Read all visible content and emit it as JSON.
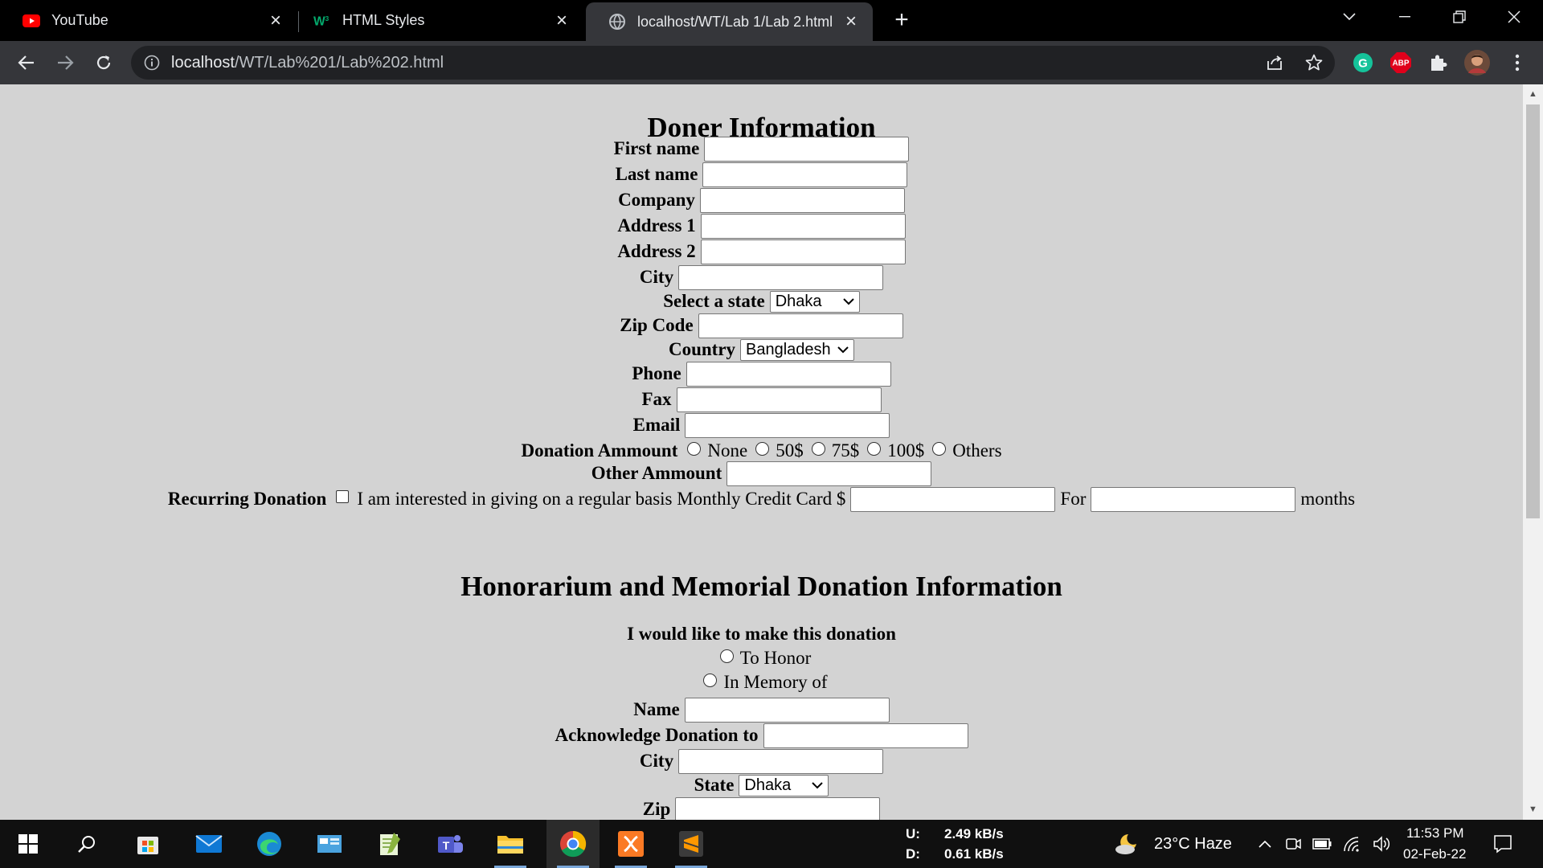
{
  "browser": {
    "tabs": [
      {
        "title": "YouTube",
        "active": false
      },
      {
        "title": "HTML Styles",
        "active": false
      },
      {
        "title": "localhost/WT/Lab 1/Lab 2.html",
        "active": true
      }
    ],
    "url_host": "localhost",
    "url_path": "/WT/Lab%201/Lab%202.html",
    "extension_abp_label": "ABP"
  },
  "page": {
    "donor_heading": "Doner Information",
    "fields": {
      "first_name": "First name",
      "last_name": "Last name",
      "company": "Company",
      "address1": "Address 1",
      "address2": "Address 2",
      "city": "City",
      "state": "Select a state",
      "state_value": "Dhaka",
      "zip": "Zip Code",
      "country": "Country",
      "country_value": "Bangladesh",
      "phone": "Phone",
      "fax": "Fax",
      "email": "Email"
    },
    "donation_amount_label": "Donation Ammount",
    "donation_options": [
      "None",
      "50$",
      "75$",
      "100$",
      "Others"
    ],
    "other_amount_label": "Other Ammount",
    "recurring_label": "Recurring Donation",
    "recurring_text": "I am interested in giving on a regular basis Monthly Credit Card $",
    "recurring_for": "For",
    "recurring_months": "months",
    "honor_heading": "Honorarium and Memorial Donation Information",
    "honor_prompt": "I would like to make this donation",
    "honor_options": [
      "To Honor",
      "In Memory of"
    ],
    "honor_fields": {
      "name": "Name",
      "acknowledge": "Acknowledge Donation to",
      "city": "City",
      "state": "State",
      "state_value": "Dhaka",
      "zip": "Zip"
    }
  },
  "taskbar": {
    "net_up_label": "U:",
    "net_up_value": "2.49 kB/s",
    "net_down_label": "D:",
    "net_down_value": "0.61 kB/s",
    "weather": "23°C  Haze",
    "time": "11:53 PM",
    "date": "02-Feb-22"
  }
}
